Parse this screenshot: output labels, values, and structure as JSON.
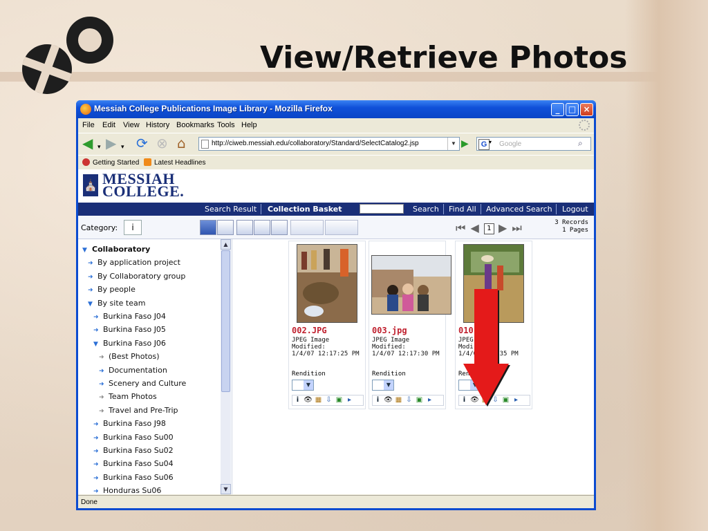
{
  "slide": {
    "title": "View/Retrieve Photos"
  },
  "window": {
    "title": "Messiah College Publications Image Library - Mozilla Firefox",
    "menu": [
      "File",
      "Edit",
      "View",
      "History",
      "Bookmarks",
      "Tools",
      "Help"
    ],
    "url": "http://ciweb.messiah.edu/collaboratory/Standard/SelectCatalog2.jsp",
    "search_placeholder": "Google",
    "search_engine_logo": "G",
    "bookmarks": [
      "Getting Started",
      "Latest Headlines"
    ],
    "status": "Done"
  },
  "brand": {
    "line1": "MESSIAH",
    "line2": "COLLEGE."
  },
  "appnav": {
    "items": [
      "Search Result",
      "Collection Basket",
      "Search",
      "Find All",
      "Advanced Search",
      "Logout"
    ]
  },
  "toolbar": {
    "category_label": "Category:",
    "category_value": "i",
    "page_number": "1",
    "records": "3 Records",
    "pages": "1 Pages"
  },
  "tree": [
    {
      "label": "Collaboratory",
      "bold": true,
      "icon": "arrow-down-icon"
    },
    {
      "label": "By application project",
      "icon": "arrow-right-icon"
    },
    {
      "label": "By Collaboratory group",
      "icon": "arrow-right-icon"
    },
    {
      "label": "By people",
      "icon": "arrow-right-icon"
    },
    {
      "label": "By site team",
      "icon": "arrow-down-icon"
    },
    {
      "label": "Burkina Faso J04",
      "icon": "arrow-right-icon"
    },
    {
      "label": "Burkina Faso J05",
      "icon": "arrow-right-icon"
    },
    {
      "label": "Burkina Faso J06",
      "icon": "arrow-down-icon"
    },
    {
      "label": "(Best Photos)",
      "icon": "arrow-right-icon",
      "grey": true
    },
    {
      "label": "Documentation",
      "icon": "arrow-right-icon"
    },
    {
      "label": "Scenery and Culture",
      "icon": "arrow-right-icon"
    },
    {
      "label": "Team Photos",
      "icon": "arrow-right-icon",
      "grey": true
    },
    {
      "label": "Travel and Pre-Trip",
      "icon": "arrow-right-icon",
      "grey": true
    },
    {
      "label": "Burkina Faso J98",
      "icon": "arrow-right-icon"
    },
    {
      "label": "Burkina Faso Su00",
      "icon": "arrow-right-icon"
    },
    {
      "label": "Burkina Faso Su02",
      "icon": "arrow-right-icon"
    },
    {
      "label": "Burkina Faso Su04",
      "icon": "arrow-right-icon"
    },
    {
      "label": "Burkina Faso Su06",
      "icon": "arrow-right-icon"
    },
    {
      "label": "Honduras Su06",
      "icon": "arrow-right-icon"
    }
  ],
  "cards": [
    {
      "filename": "002.JPG",
      "type": "JPEG Image",
      "modified_label": "Modified:",
      "modified": "1/4/07 12:17:25 PM",
      "rendition_label": "Rendition"
    },
    {
      "filename": "003.jpg",
      "type": "JPEG Image",
      "modified_label": "Modified:",
      "modified": "1/4/07 12:17:30 PM",
      "rendition_label": "Rendition"
    },
    {
      "filename": "010",
      "type": "JPEG",
      "modified_label": "Modi",
      "modified": "1/4/0   17:35 PM",
      "rendition_label": "Ren"
    }
  ],
  "card_actions": [
    "info-icon",
    "view-icon",
    "basket-icon",
    "download-icon",
    "export-icon",
    "more-icon"
  ],
  "colors": {
    "nav_bg": "#1a2f78",
    "filename_red": "#c0202e",
    "arrow_red": "#e41a1a"
  }
}
